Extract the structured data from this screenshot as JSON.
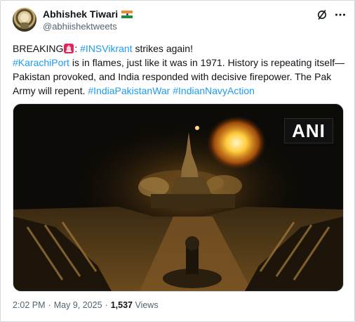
{
  "author": {
    "display_name": "Abhishek Tiwari",
    "handle": "@abhiishektweets",
    "flag_icon": "india-flag-icon"
  },
  "actions": {
    "grok_icon": "grok-slash-icon",
    "more_icon": "more-options-icon"
  },
  "tweet": {
    "breaking": "BREAKING",
    "siren_icon": "siren-emoji-icon",
    "colon": ": ",
    "tag_insvikrant": "#INSVikrant",
    "strikes_again": " strikes again!",
    "tag_karachiport": "#KarachiPort",
    "body_line": " is in flames, just like it was in 1971. History is repeating itself—Pakistan provoked, and India responded with decisive firepower. The Pak Army will repent. ",
    "tag_war": "#IndiaPakistanWar",
    "space": " ",
    "tag_navy": "#IndianNavyAction"
  },
  "media": {
    "watermark": "ANI"
  },
  "meta": {
    "time": "2:02 PM",
    "dot1": "·",
    "date": "May 9, 2025",
    "dot2": "·",
    "views_count": "1,537",
    "views_label": "Views"
  },
  "colors": {
    "link": "#1d9bf0",
    "text": "#0f1419",
    "secondary": "#536471"
  }
}
